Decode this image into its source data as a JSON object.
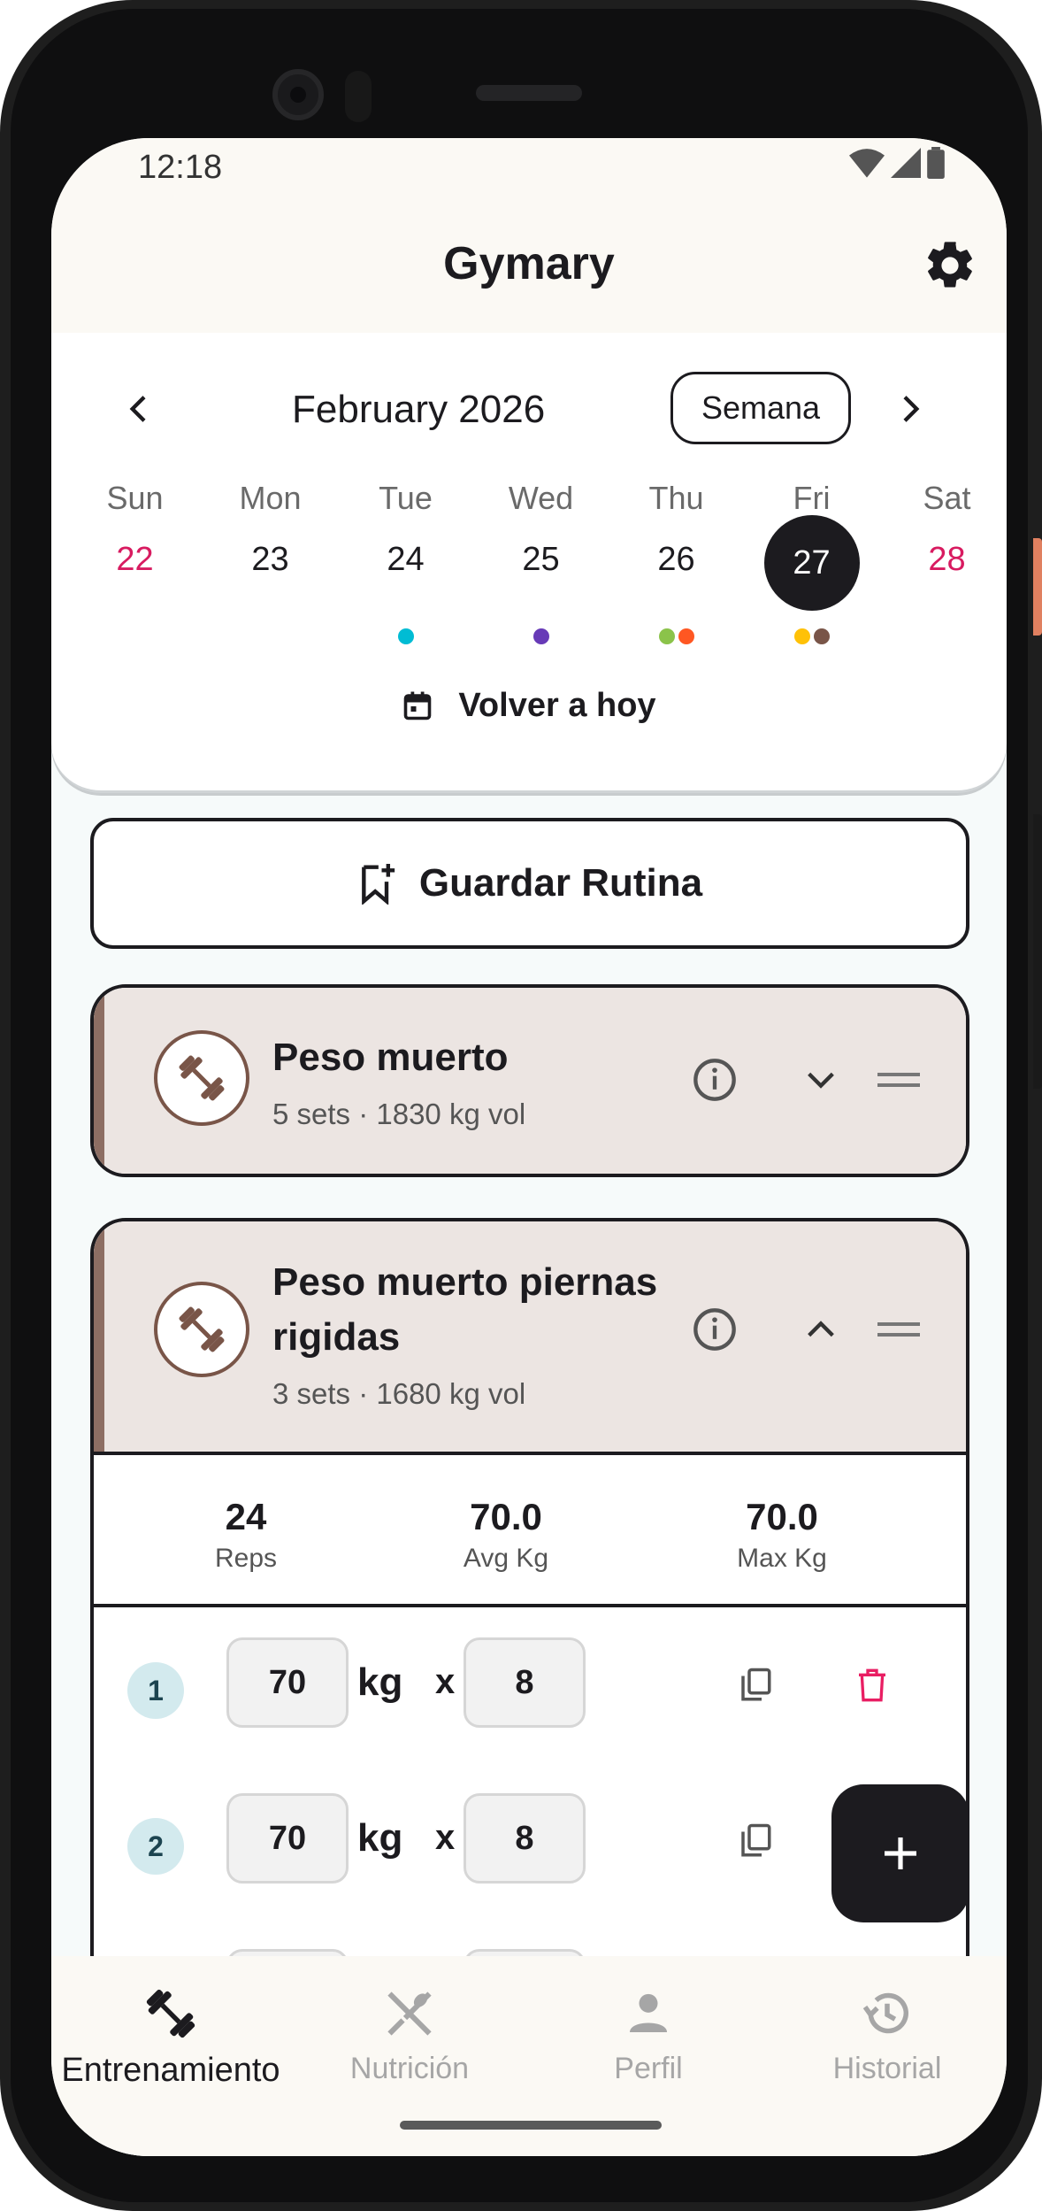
{
  "status": {
    "time": "12:18"
  },
  "app": {
    "title": "Gymary"
  },
  "calendar": {
    "month": "February 2026",
    "view_button": "Semana",
    "weekdays": [
      "Sun",
      "Mon",
      "Tue",
      "Wed",
      "Thu",
      "Fri",
      "Sat"
    ],
    "days": [
      "22",
      "23",
      "24",
      "25",
      "26",
      "27",
      "28"
    ],
    "selected_day": "27",
    "event_dot_colors": [
      [],
      [],
      [
        "#00bcd4"
      ],
      [
        "#673ab7"
      ],
      [
        "#8bc34a",
        "#ff5722"
      ],
      [
        "#ffc107",
        "#795548"
      ],
      []
    ],
    "today_link": "Volver a hoy"
  },
  "save_routine": {
    "label": "Guardar Rutina"
  },
  "exercises": [
    {
      "name": "Peso muerto",
      "summary": "5 sets · 1830 kg vol",
      "expanded": false
    },
    {
      "name": "Peso muerto piernas rigidas",
      "summary": "3 sets · 1680 kg vol",
      "expanded": true,
      "stats": [
        {
          "value": "24",
          "label": "Reps"
        },
        {
          "value": "70.0",
          "label": "Avg Kg"
        },
        {
          "value": "70.0",
          "label": "Max Kg"
        }
      ],
      "sets": [
        {
          "number": "1",
          "weight": "70",
          "unit": "kg",
          "times": "x",
          "reps": "8"
        },
        {
          "number": "2",
          "weight": "70",
          "unit": "kg",
          "times": "x",
          "reps": "8"
        }
      ]
    }
  ],
  "fab": {
    "icon": "plus-icon"
  },
  "nav": [
    {
      "label": "Entrenamiento",
      "icon": "dumbbell-icon",
      "active": true
    },
    {
      "label": "Nutrición",
      "icon": "utensils-icon",
      "active": false
    },
    {
      "label": "Perfil",
      "icon": "person-icon",
      "active": false
    },
    {
      "label": "Historial",
      "icon": "history-icon",
      "active": false
    }
  ],
  "colors": {
    "accent": "#1c1b1f",
    "weekend": "#d81b60",
    "card_header": "#ece5e2",
    "delete": "#e91e63"
  }
}
